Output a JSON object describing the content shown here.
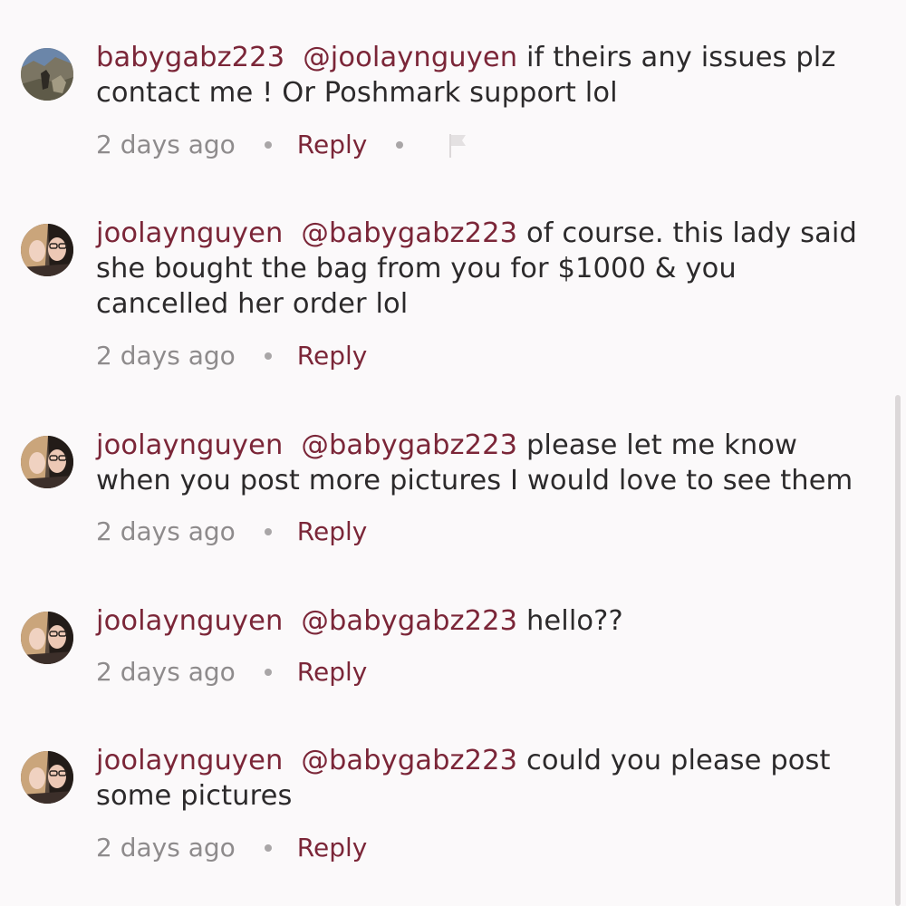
{
  "comments": [
    {
      "author": "babygabz223",
      "mention": "@joolaynguyen",
      "body": " if theirs any issues plz contact me ! Or Poshmark support lol",
      "time": "2 days ago",
      "reply_label": "Reply",
      "has_flag": true,
      "avatar": "outdoor-photo-avatar"
    },
    {
      "author": "joolaynguyen",
      "mention": "@babygabz223",
      "body": " of course. this lady said she bought the bag from you for $1000 & you cancelled her order lol",
      "time": "2 days ago",
      "reply_label": "Reply",
      "avatar": "two-people-avatar"
    },
    {
      "author": "joolaynguyen",
      "mention": "@babygabz223",
      "body": " please let me know when you post more pictures I would love to see them",
      "time": "2 days ago",
      "reply_label": "Reply",
      "avatar": "two-people-avatar"
    },
    {
      "author": "joolaynguyen",
      "mention": "@babygabz223",
      "body": " hello??",
      "time": "2 days ago",
      "reply_label": "Reply",
      "avatar": "two-people-avatar"
    },
    {
      "author": "joolaynguyen",
      "mention": "@babygabz223",
      "body": " could you please post some pictures",
      "time": "2 days ago",
      "reply_label": "Reply",
      "avatar": "two-people-avatar"
    }
  ],
  "icons": {
    "flag": "flag-icon"
  },
  "colors": {
    "accent": "#7b2638",
    "text": "#2c2a2b",
    "muted": "#8e8b8c",
    "background": "#fbf9fa"
  }
}
